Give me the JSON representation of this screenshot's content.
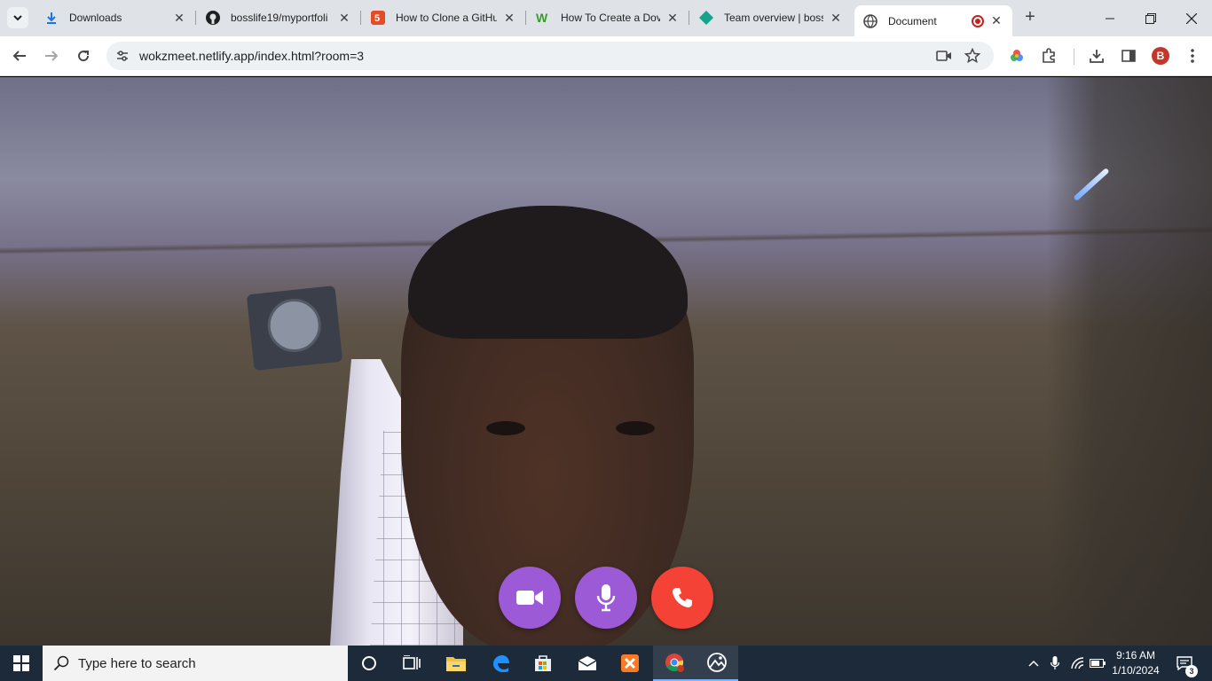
{
  "browser": {
    "tabs": [
      {
        "title": "Downloads",
        "favicon": "download-icon",
        "active": false
      },
      {
        "title": "bosslife19/myportfoli",
        "favicon": "github-icon",
        "active": false
      },
      {
        "title": "How to Clone a GitHu",
        "favicon": "hashnode-icon",
        "active": false
      },
      {
        "title": "How To Create a Dov",
        "favicon": "w-logo-icon",
        "active": false
      },
      {
        "title": "Team overview | boss",
        "favicon": "diamond-icon",
        "active": false
      },
      {
        "title": "Document",
        "favicon": "globe-icon",
        "active": true,
        "recording": true
      }
    ],
    "url": "wokzmeet.netlify.app/index.html?room=3",
    "profile_initial": "B",
    "colors": {
      "tabstrip": "#dfe3e8",
      "omnibox": "#eef1f4",
      "profile": "#c5362a"
    }
  },
  "call": {
    "video_button": {
      "icon": "video-camera-icon",
      "color": "#9c5ad6"
    },
    "mic_button": {
      "icon": "microphone-icon",
      "color": "#9c5ad6"
    },
    "end_button": {
      "icon": "phone-hangup-icon",
      "color": "#f44336"
    }
  },
  "taskbar": {
    "search_placeholder": "Type here to search",
    "time": "9:16 AM",
    "date": "1/10/2024",
    "notification_count": "3",
    "apps": [
      "cortana-icon",
      "task-view-icon",
      "file-explorer-icon",
      "edge-icon",
      "store-icon",
      "mail-icon",
      "xampp-icon",
      "chrome-icon",
      "photos-icon"
    ]
  }
}
